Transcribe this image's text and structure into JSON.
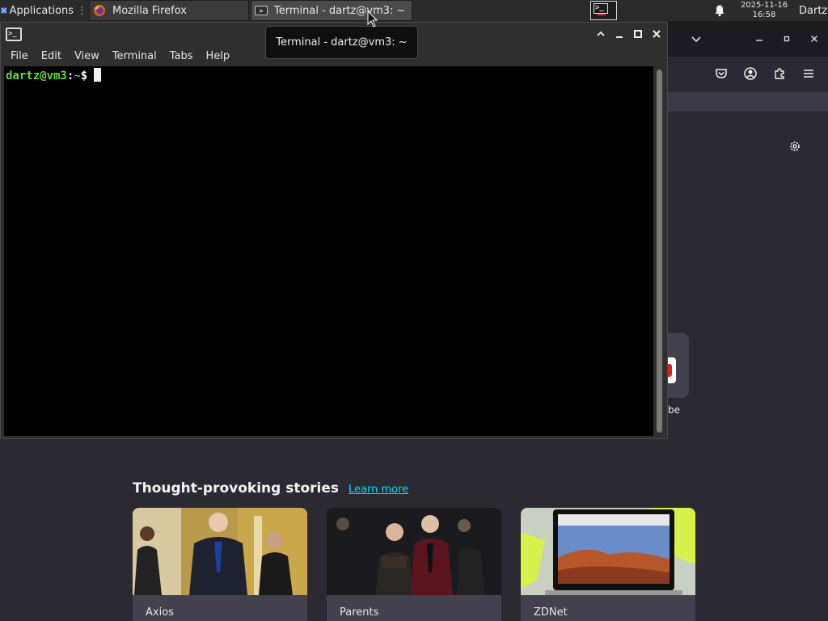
{
  "panel": {
    "applications_label": "Applications",
    "tasks": [
      {
        "title": "Mozilla Firefox",
        "icon": "firefox-icon"
      },
      {
        "title": "Terminal - dartz@vm3: ~",
        "icon": "terminal-icon"
      }
    ],
    "workspace_icon_text": ">_",
    "notification_icon": "bell-icon",
    "clock": {
      "date": "2025-11-16",
      "time": "16:58"
    },
    "user": "Dartz"
  },
  "terminal": {
    "window_title": "Terminal - dartz@vm3: ~",
    "menu": [
      "File",
      "Edit",
      "View",
      "Terminal",
      "Tabs",
      "Help"
    ],
    "prompt_user": "dartz@vm3",
    "prompt_colon": ":",
    "prompt_path": "~",
    "prompt_symbol": "$",
    "colors": {
      "user": "#5fdf2f",
      "path": "#6b9bff",
      "background": "#000000"
    }
  },
  "tooltip": {
    "text": "Terminal - dartz@vm3: ~"
  },
  "firefox": {
    "shortcut_label_partial": "be",
    "stories": {
      "heading": "Thought-provoking stories",
      "learn_more": "Learn more",
      "cards": [
        {
          "source": "Axios"
        },
        {
          "source": "Parents"
        },
        {
          "source": "ZDNet"
        }
      ]
    },
    "accent_link_color": "#00ddff"
  }
}
